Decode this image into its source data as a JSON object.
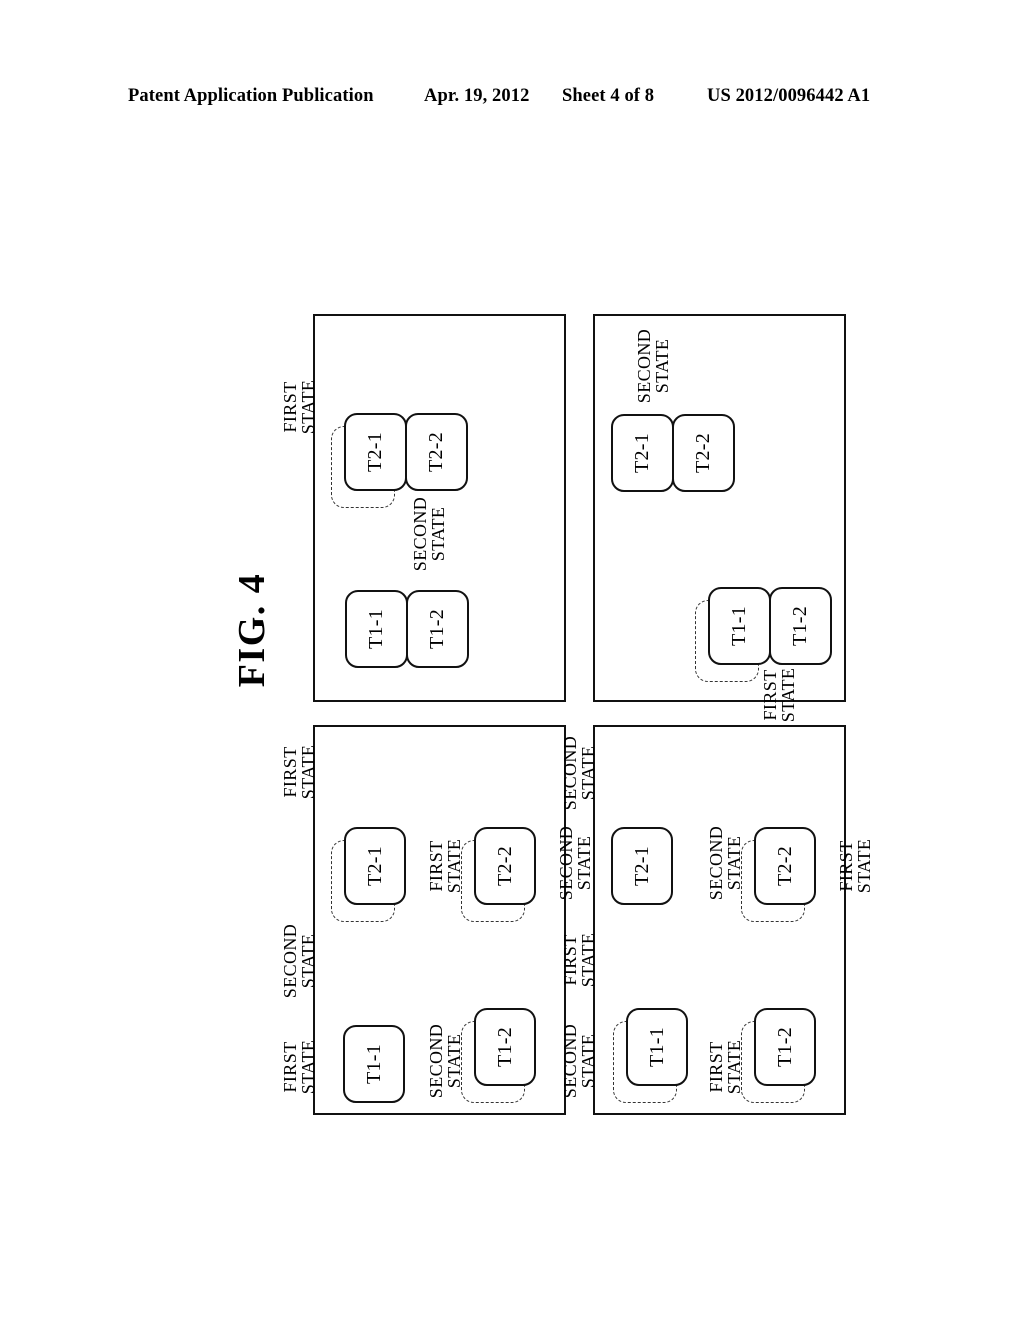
{
  "header": {
    "publication": "Patent Application Publication",
    "date": "Apr. 19, 2012",
    "sheet": "Sheet 4 of 8",
    "number": "US 2012/0096442 A1"
  },
  "figure": {
    "label": "FIG. 4",
    "panel_count": 4
  },
  "labels": {
    "first_state": "FIRST\nSTATE",
    "second_state": "SECOND\nSTATE"
  },
  "nodes": {
    "t1_1": "T1-1",
    "t1_2": "T1-2",
    "t2_1": "T2-1",
    "t2_2": "T2-2"
  },
  "panels": [
    {
      "id": "panel-top-left",
      "position": "top-left",
      "nodes": [
        {
          "name": "T1-1",
          "ghost": false,
          "state": "SECOND\nSTATE"
        },
        {
          "name": "T1-2",
          "ghost": false,
          "state": null
        },
        {
          "name": "T2-1",
          "ghost": true,
          "state": "FIRST\nSTATE"
        },
        {
          "name": "T2-2",
          "ghost": false,
          "state": null
        }
      ]
    },
    {
      "id": "panel-top-right",
      "position": "top-right",
      "nodes": [
        {
          "name": "T2-1",
          "ghost": false,
          "state": "SECOND\nSTATE"
        },
        {
          "name": "T2-2",
          "ghost": false,
          "state": null
        },
        {
          "name": "T1-1",
          "ghost": true,
          "state": "FIRST\nSTATE"
        },
        {
          "name": "T1-2",
          "ghost": false,
          "state": null
        }
      ]
    },
    {
      "id": "panel-bottom-left",
      "position": "bottom-left",
      "nodes": [
        {
          "name": "T1-1",
          "ghost": false,
          "state": "SECOND\nSTATE"
        },
        {
          "name": "T1-2",
          "ghost": true,
          "state": "FIRST\nSTATE"
        },
        {
          "name": "T2-1",
          "ghost": true,
          "state": "FIRST\nSTATE"
        },
        {
          "name": "T2-2",
          "ghost": true,
          "state": "FIRST\nSTATE"
        }
      ],
      "extra_states": [
        "SECOND\nSTATE",
        "SECOND\nSTATE"
      ]
    },
    {
      "id": "panel-bottom-right",
      "position": "bottom-right",
      "nodes": [
        {
          "name": "T2-1",
          "ghost": false,
          "state": "SECOND\nSTATE"
        },
        {
          "name": "T2-2",
          "ghost": true,
          "state": "SECOND\nSTATE"
        },
        {
          "name": "T1-1",
          "ghost": true,
          "state": "FIRST\nSTATE"
        },
        {
          "name": "T1-2",
          "ghost": true,
          "state": "FIRST\nSTATE"
        }
      ],
      "extra_states": [
        "FIRST\nSTATE",
        "SECOND\nSTATE"
      ]
    }
  ],
  "panel_tl": {
    "n1": "T1-1",
    "n2": "T1-2",
    "n3": "T2-1",
    "n4": "T2-2",
    "s1": "SECOND\nSTATE",
    "s2": "FIRST\nSTATE"
  },
  "panel_tr": {
    "n1": "T2-1",
    "n2": "T2-2",
    "n3": "T1-1",
    "n4": "T1-2",
    "s1": "SECOND\nSTATE",
    "s2": "FIRST\nSTATE"
  },
  "panel_bl": {
    "n1": "T1-1",
    "n2": "T1-2",
    "n3": "T2-1",
    "n4": "T2-2",
    "s1": "SECOND\nSTATE",
    "s2": "FIRST\nSTATE",
    "s3": "SECOND\nSTATE",
    "s4": "FIRST\nSTATE",
    "s5": "SECOND\nSTATE",
    "s6": "FIRST\nSTATE"
  },
  "panel_br": {
    "n1": "T1-1",
    "n2": "T1-2",
    "n3": "T2-1",
    "n4": "T2-2",
    "s1": "FIRST\nSTATE",
    "s2": "SECOND\nSTATE",
    "s3": "FIRST\nSTATE",
    "s4": "SECOND\nSTATE",
    "s5": "FIRST\nSTATE",
    "s6": "SECOND\nSTATE"
  }
}
